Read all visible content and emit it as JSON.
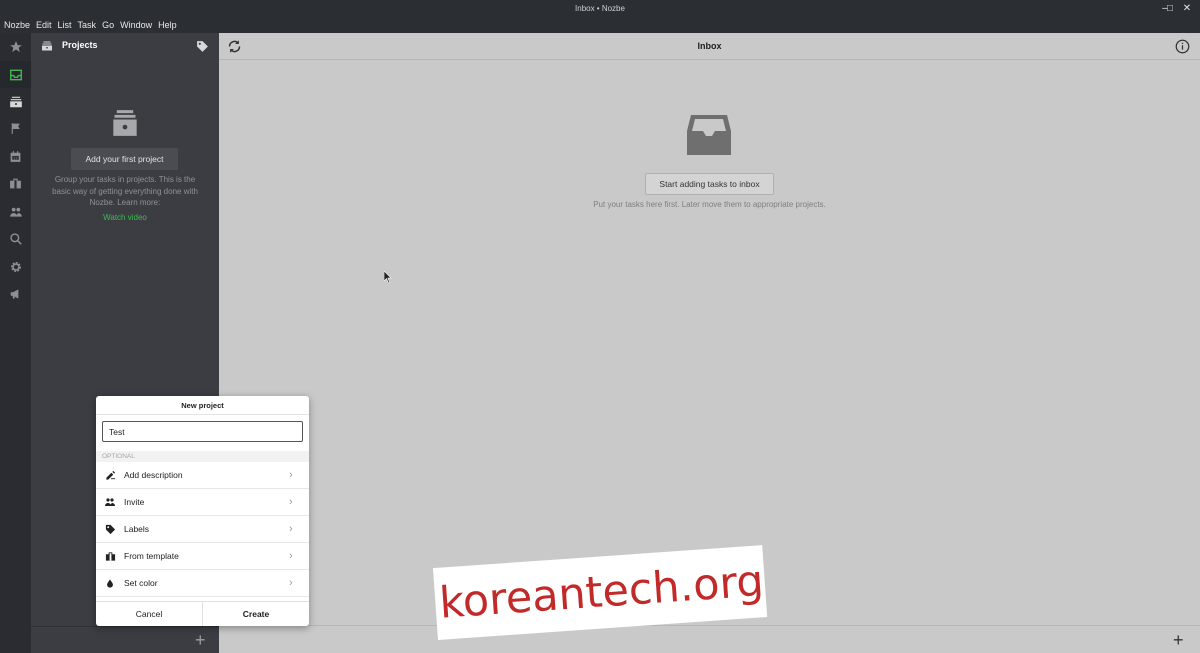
{
  "window": {
    "title": "Inbox • Nozbe",
    "controls": [
      "minimize",
      "maximize",
      "close"
    ]
  },
  "menubar": {
    "items": [
      "Nozbe",
      "Edit",
      "List",
      "Task",
      "Go",
      "Window",
      "Help"
    ]
  },
  "sidebar": {
    "icons": [
      "star-icon",
      "inbox-icon",
      "projects-icon",
      "flag-icon",
      "calendar-icon",
      "briefcase-icon",
      "team-icon",
      "search-icon",
      "settings-icon",
      "megaphone-icon"
    ],
    "active": "inbox-icon"
  },
  "projects_pane": {
    "title": "Projects",
    "add_button": "Add your first project",
    "description": "Group your tasks in projects. This is the basic way of getting everything done with Nozbe. Learn more:",
    "watch_link": "Watch video"
  },
  "main": {
    "title": "Inbox",
    "start_button": "Start adding tasks to inbox",
    "description": "Put your tasks here first. Later move them to appropriate projects."
  },
  "dialog": {
    "title": "New project",
    "name_value": "Test",
    "optional_label": "OPTIONAL",
    "options": [
      {
        "icon": "pencil-icon",
        "label": "Add description"
      },
      {
        "icon": "invite-icon",
        "label": "Invite"
      },
      {
        "icon": "tag-icon",
        "label": "Labels"
      },
      {
        "icon": "template-icon",
        "label": "From template"
      },
      {
        "icon": "color-drop-icon",
        "label": "Set color"
      }
    ],
    "cancel": "Cancel",
    "create": "Create"
  },
  "watermark": {
    "text": "koreantech.org",
    "color": "#c22a2a"
  },
  "colors": {
    "accent_green": "#3fb950",
    "sidebar_bg": "#2a2c31",
    "projects_bg": "#3b3d43",
    "main_bg": "#c9c9c9"
  }
}
